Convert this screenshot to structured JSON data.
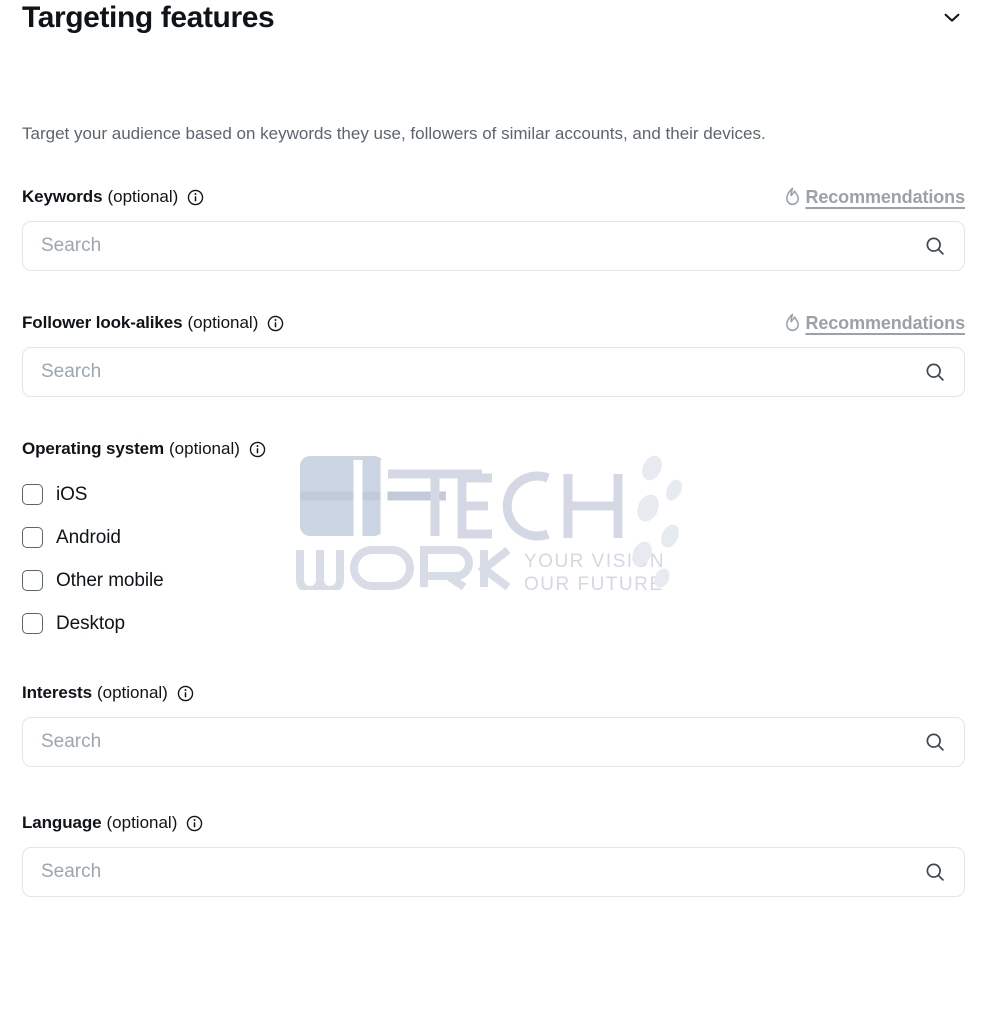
{
  "header": {
    "title": "Targeting features",
    "collapse_icon": "chevron-down-icon"
  },
  "subtitle": "Target your audience based on keywords they use, followers of similar accounts, and their devices.",
  "common": {
    "optional_suffix": "(optional)",
    "info_icon": "info-icon",
    "search_icon": "search-icon",
    "search_placeholder": "Search",
    "recommendations_label": "Recommendations",
    "recommendations_icon": "flame-icon"
  },
  "fields": {
    "keywords": {
      "label": "Keywords",
      "optional": "(optional)",
      "search_value": "",
      "placeholder": "Search",
      "recommendations_label": "Recommendations"
    },
    "follower_look_alikes": {
      "label": "Follower look-alikes",
      "optional": "(optional)",
      "search_value": "",
      "placeholder": "Search",
      "recommendations_label": "Recommendations"
    },
    "operating_system": {
      "label": "Operating system",
      "optional": "(optional)",
      "options": [
        {
          "label": "iOS",
          "checked": false
        },
        {
          "label": "Android",
          "checked": false
        },
        {
          "label": "Other mobile",
          "checked": false
        },
        {
          "label": "Desktop",
          "checked": false
        }
      ]
    },
    "interests": {
      "label": "Interests",
      "optional": "(optional)",
      "search_value": "",
      "placeholder": "Search"
    },
    "language": {
      "label": "Language",
      "optional": "(optional)",
      "search_value": "",
      "placeholder": "Search"
    }
  },
  "watermark": {
    "brand_primary": "HI",
    "brand_tech": "TECH",
    "brand_work": "WORK",
    "tagline_line1": "YOUR VISION",
    "tagline_line2": "OUR FUTURE"
  },
  "colors": {
    "text_primary": "#0f1419",
    "text_muted": "#5b6570",
    "placeholder": "#9aa6b2",
    "border": "#e3e6e8",
    "recommendation_link": "#9aa2a9",
    "watermark": "#c9cfdd"
  }
}
